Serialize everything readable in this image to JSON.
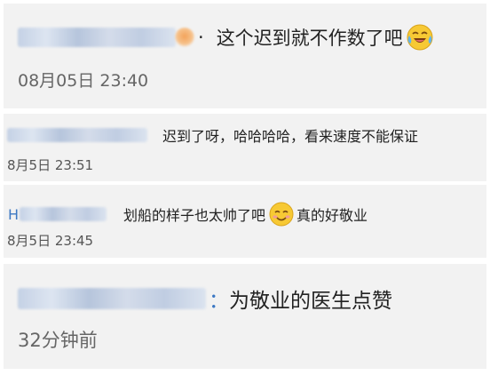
{
  "comments": [
    {
      "name_visible": "",
      "separator": "·",
      "text": "这个迟到就不作数了吧",
      "time": "08月05日 23:40",
      "emoji_icon": "laughing-crying-emoji-icon"
    },
    {
      "name_visible": "",
      "separator": "",
      "text": "迟到了呀，哈哈哈哈，看来速度不能保证",
      "time": "8月5日 23:51"
    },
    {
      "name_visible": "",
      "separator": "",
      "text_before": "划船的样子也太帅了吧",
      "text_after": "真的好敬业",
      "time": "8月5日 23:45",
      "emoji_icon": "smiling-blush-emoji-icon"
    },
    {
      "name_visible": "",
      "separator": "：",
      "text": "为敬业的医生点赞",
      "time": "32分钟前"
    }
  ]
}
